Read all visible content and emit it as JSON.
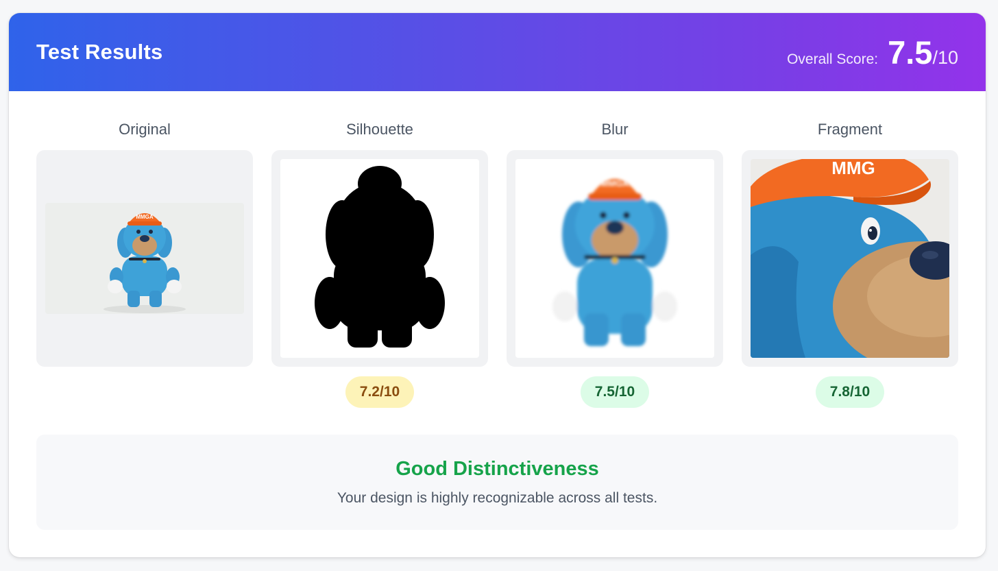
{
  "header": {
    "title": "Test Results",
    "score_label": "Overall Score:",
    "score_value": "7.5",
    "score_max": "/10"
  },
  "tests": [
    {
      "label": "Original",
      "image": "mascot-full-figure",
      "score": null
    },
    {
      "label": "Silhouette",
      "image": "mascot-silhouette",
      "score": "7.2/10",
      "badge_color": "#fdf3b8"
    },
    {
      "label": "Blur",
      "image": "mascot-blurred",
      "score": "7.5/10",
      "badge_color": "#dcfce7"
    },
    {
      "label": "Fragment",
      "image": "mascot-closeup",
      "score": "7.8/10",
      "badge_color": "#dcfce7"
    }
  ],
  "summary": {
    "title": "Good Distinctiveness",
    "text": "Your design is highly recognizable across all tests."
  },
  "mascot": {
    "cap_text": "MMGA",
    "cap_text_cropped": "MMG"
  },
  "colors": {
    "header_start": "#2f63ea",
    "header_end": "#9333ea",
    "good": "#16a34a",
    "fur": "#3b9fd6",
    "cap": "#f26a22"
  }
}
